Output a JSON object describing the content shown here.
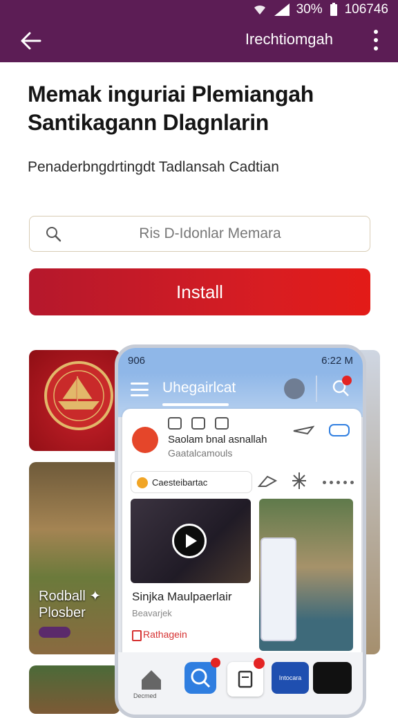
{
  "status_bar": {
    "battery": "30%",
    "time": "106746"
  },
  "app_bar": {
    "title": "Irechtiomgah"
  },
  "headline": "Memak inguriai Plemiangah Santikagann Dlagnlarin",
  "subtitle": "Penaderbngdrtingdt Tadlansah Cadtian",
  "search": {
    "placeholder": "Ris D-Idonlar Memara"
  },
  "install_button": {
    "label": "Install"
  },
  "cards": {
    "village_caption": "Rodball ✦ Plosber"
  },
  "phone": {
    "status_time": "6:22 M",
    "status_mid": "906",
    "app_title": "Uhegairlcat",
    "panel": {
      "title": "Saolam bnal asnallah",
      "subtitle": "Gaatalcamouls",
      "chip_label": "Caesteibartac"
    },
    "video": {
      "title": "Sinjka Maulpaerlair",
      "subtitle": "Beavarjek",
      "tag": "Rathagein"
    },
    "nav": {
      "home_label": "Decmed",
      "brand_label": "Intocara"
    }
  },
  "colors": {
    "brand_purple": "#5c1d55",
    "install_red": "#d81d22"
  },
  "icons": [
    "back-arrow-icon",
    "more-vert-icon",
    "search-icon",
    "wifi-icon",
    "signal-icon",
    "battery-icon",
    "play-icon",
    "home-icon",
    "gear-icon"
  ]
}
